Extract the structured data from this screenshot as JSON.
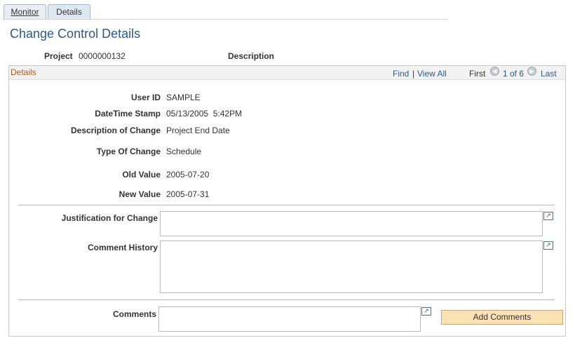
{
  "tabs": [
    {
      "label": "Monitor"
    },
    {
      "label": "Details"
    }
  ],
  "page_title": "Change Control Details",
  "header": {
    "project_label": "Project",
    "project_value": "0000000132",
    "description_label": "Description"
  },
  "details_box": {
    "title": "Details",
    "find_link": "Find",
    "view_all_link": "View All",
    "first_label": "First",
    "pager_text": "1 of 6",
    "last_label": "Last"
  },
  "fields": {
    "user_id_label": "User ID",
    "user_id_value": "SAMPLE",
    "datetime_label": "DateTime Stamp",
    "datetime_value": "05/13/2005  5:42PM",
    "desc_change_label": "Description of Change",
    "desc_change_value": "Project End Date",
    "type_change_label": "Type Of Change",
    "type_change_value": "Schedule",
    "old_value_label": "Old Value",
    "old_value_value": "2005-07-20",
    "new_value_label": "New Value",
    "new_value_value": "2005-07-31"
  },
  "text_areas": {
    "justification_label": "Justification for Change",
    "comment_history_label": "Comment History",
    "comments_label": "Comments"
  },
  "add_comments_button": "Add Comments"
}
